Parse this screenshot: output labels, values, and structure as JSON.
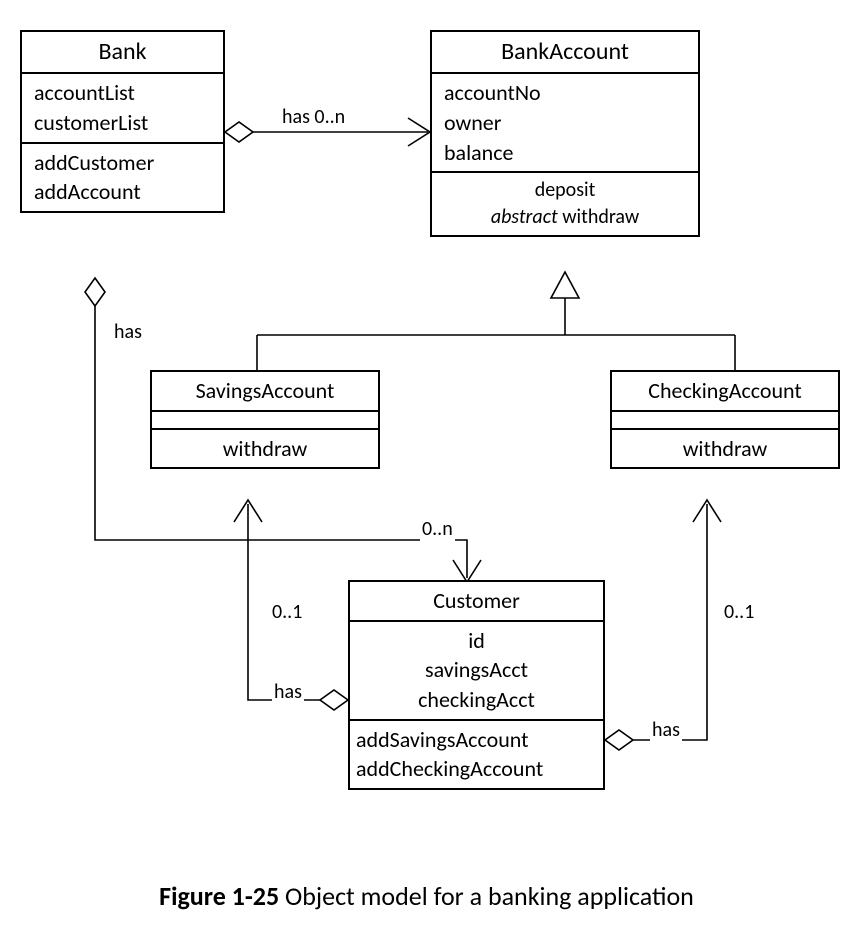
{
  "classes": {
    "bank": {
      "name": "Bank",
      "attributes": [
        "accountList",
        "customerList"
      ],
      "operations": [
        "addCustomer",
        "addAccount"
      ]
    },
    "bankAccount": {
      "name": "BankAccount",
      "attributes": [
        "accountNo",
        "owner",
        "balance"
      ],
      "operations": {
        "deposit": "deposit",
        "withdraw_prefix": "abstract",
        "withdraw": " withdraw"
      }
    },
    "savingsAccount": {
      "name": "SavingsAccount",
      "operations": [
        "withdraw"
      ]
    },
    "checkingAccount": {
      "name": "CheckingAccount",
      "operations": [
        "withdraw"
      ]
    },
    "customer": {
      "name": "Customer",
      "attributes": [
        "id",
        "savingsAcct",
        "checkingAcct"
      ],
      "operations": [
        "addSavingsAccount",
        "addCheckingAccount"
      ]
    }
  },
  "relationships": {
    "bank_has_bankAccount": {
      "label": "has 0..n",
      "type": "aggregation_with_open_arrow"
    },
    "bank_has_customer": {
      "label": "has",
      "mult": "0..n",
      "type": "aggregation_with_open_arrow"
    },
    "customer_has_savings": {
      "label": "has",
      "mult": "0..1",
      "type": "aggregation_with_open_arrow"
    },
    "customer_has_checking": {
      "label": "has",
      "mult": "0..1",
      "type": "aggregation_with_open_arrow"
    },
    "savings_isa_bankAccount": {
      "type": "generalization"
    },
    "checking_isa_bankAccount": {
      "type": "generalization"
    }
  },
  "labels": {
    "has": "has",
    "has_0n": "has 0..n",
    "m_0n": "0..n",
    "m_01": "0..1"
  },
  "caption": {
    "bold": "Figure 1-25",
    "rest": " Object model for a banking application"
  }
}
